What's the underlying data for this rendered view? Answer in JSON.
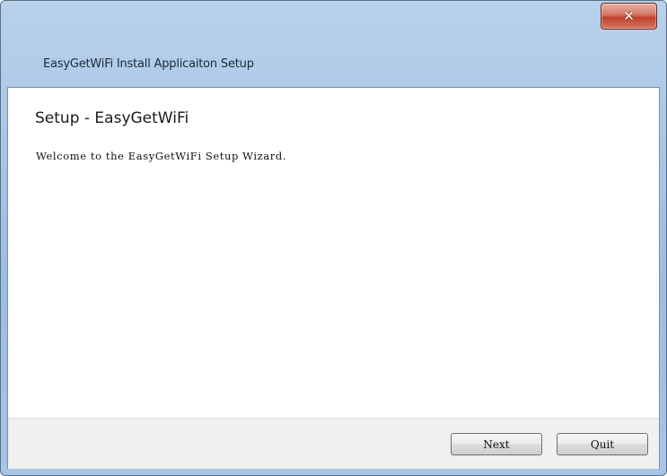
{
  "window": {
    "title": "EasyGetWiFi Install Applicaiton Setup",
    "close_icon": "close-icon",
    "close_glyph": "✕"
  },
  "content": {
    "heading": "Setup - EasyGetWiFi",
    "welcome_text": "Welcome to the EasyGetWiFi Setup Wizard."
  },
  "footer": {
    "next_label": "Next",
    "quit_label": "Quit"
  },
  "colors": {
    "titlebar": "#a9c6e6",
    "close_button": "#c0432b",
    "client_background": "#ffffff",
    "footer_background": "#f0f0f0"
  }
}
